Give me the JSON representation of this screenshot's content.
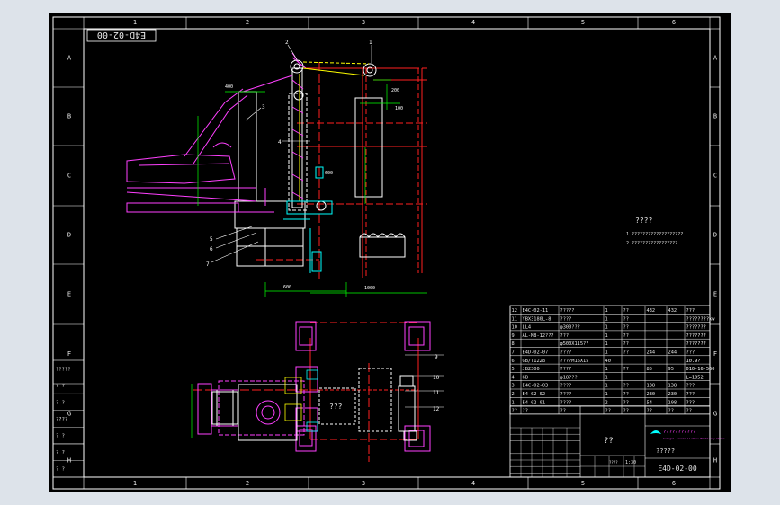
{
  "drawing_number": "E4D-02-00",
  "title_stamp": "E4D-02-00",
  "border": {
    "columns": [
      "1",
      "2",
      "3",
      "4",
      "5",
      "6"
    ],
    "rows": [
      "A",
      "B",
      "C",
      "D",
      "E",
      "F",
      "G",
      "H"
    ]
  },
  "notes": {
    "heading": "????",
    "line1": "1.???????????????????",
    "line2": "2.?????????????????"
  },
  "labels": {
    "comp": "???",
    "balloons": [
      "1",
      "2",
      "3",
      "4",
      "5",
      "6",
      "7",
      "8",
      "9",
      "10",
      "11",
      "12"
    ]
  },
  "bom": [
    {
      "no": "12",
      "code": "E4C-02-11",
      "name": "?????",
      "qty": "1",
      "mat": "??",
      "w1": "432",
      "w2": "432",
      "note": "???"
    },
    {
      "no": "11",
      "code": "YBX3180L-8",
      "name": "????",
      "qty": "1",
      "mat": "??",
      "w1": "",
      "w2": "",
      "note": "????????kw"
    },
    {
      "no": "10",
      "code": "LL4",
      "name": "φ300???",
      "qty": "1",
      "mat": "??",
      "w1": "",
      "w2": "",
      "note": "???????"
    },
    {
      "no": "9",
      "code": "AL-M8-12???",
      "name": "???",
      "qty": "1",
      "mat": "??",
      "w1": "",
      "w2": "",
      "note": "???????"
    },
    {
      "no": "8",
      "code": "",
      "name": "φ500X115??",
      "qty": "1",
      "mat": "??",
      "w1": "",
      "w2": "",
      "note": "???????"
    },
    {
      "no": "7",
      "code": "E4D-02-07",
      "name": "????",
      "qty": "1",
      "mat": "??",
      "w1": "244",
      "w2": "244",
      "note": "???"
    },
    {
      "no": "6",
      "code": "GB/T1228",
      "name": "????M16X15",
      "qty": "40",
      "mat": "",
      "w1": "",
      "w2": "",
      "note": "10.9?"
    },
    {
      "no": "5",
      "code": "JB2300",
      "name": "????",
      "qty": "1",
      "mat": "??",
      "w1": "85",
      "w2": "95",
      "note": "010-16-560"
    },
    {
      "no": "4",
      "code": "GB",
      "name": "φ18???",
      "qty": "1",
      "mat": "",
      "w1": "",
      "w2": "",
      "note": "L=1052"
    },
    {
      "no": "3",
      "code": "E4C-02-03",
      "name": "????",
      "qty": "1",
      "mat": "??",
      "w1": "138",
      "w2": "138",
      "note": "???"
    },
    {
      "no": "2",
      "code": "E4-02-02",
      "name": "????",
      "qty": "1",
      "mat": "??",
      "w1": "230",
      "w2": "230",
      "note": "???"
    },
    {
      "no": "1",
      "code": "E4-02-01",
      "name": "????",
      "qty": "2",
      "mat": "??",
      "w1": "54",
      "w2": "108",
      "note": "???"
    }
  ],
  "bom_header": [
    "??",
    "??",
    "??",
    "??",
    "??",
    "??",
    "??",
    "??"
  ],
  "title_block": {
    "company": "???????????",
    "company_en": "Guangxi Jinnan Liuzhou Machinery Works",
    "name": "??",
    "subname": "?????",
    "scale": "1:30",
    "sheet": "????",
    "drawing_no": "E4D-02-00"
  },
  "side_table": [
    "?????",
    "?  ?",
    "?  ?",
    "????",
    "?  ?",
    "?  ?",
    "?  ?"
  ]
}
